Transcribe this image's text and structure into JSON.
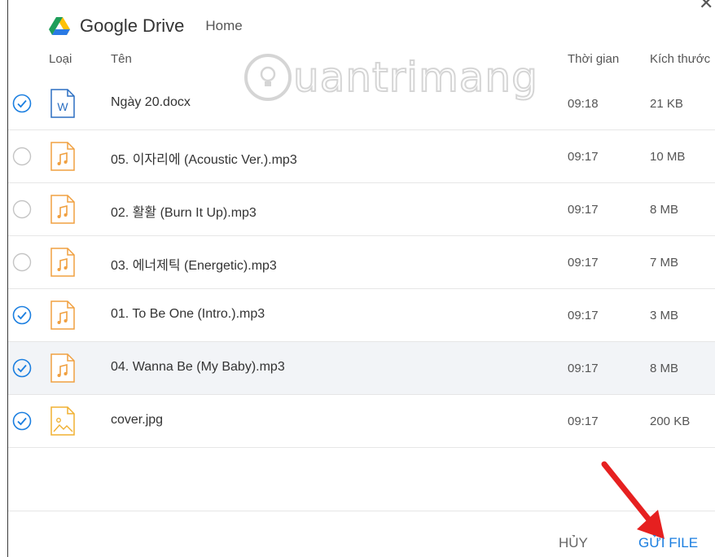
{
  "header": {
    "app_title": "Google Drive",
    "breadcrumb": "Home",
    "close_glyph": "✕"
  },
  "columns": {
    "type": "Loại",
    "name": "Tên",
    "time": "Thời gian",
    "size": "Kích thước"
  },
  "watermark": {
    "text": "uantrimang"
  },
  "files": [
    {
      "name": "Ngày 20.docx",
      "time": "09:18",
      "size": "21 KB",
      "checked": true,
      "icon": "word-doc-icon"
    },
    {
      "name": "05. 이자리에 (Acoustic Ver.).mp3",
      "time": "09:17",
      "size": "10 MB",
      "checked": false,
      "icon": "music-file-icon"
    },
    {
      "name": "02. 활활 (Burn It Up).mp3",
      "time": "09:17",
      "size": "8 MB",
      "checked": false,
      "icon": "music-file-icon"
    },
    {
      "name": "03. 에너제틱 (Energetic).mp3",
      "time": "09:17",
      "size": "7 MB",
      "checked": false,
      "icon": "music-file-icon"
    },
    {
      "name": "01. To Be One (Intro.).mp3",
      "time": "09:17",
      "size": "3 MB",
      "checked": true,
      "icon": "music-file-icon"
    },
    {
      "name": "04. Wanna Be (My Baby).mp3",
      "time": "09:17",
      "size": "8 MB",
      "checked": true,
      "icon": "music-file-icon"
    },
    {
      "name": "cover.jpg",
      "time": "09:17",
      "size": "200 KB",
      "checked": true,
      "icon": "image-file-icon"
    }
  ],
  "footer": {
    "cancel_label": "HỦY",
    "send_label": "GỬI FILE"
  },
  "colors": {
    "accent": "#1a7ee0",
    "music_icon": "#f0a040",
    "word_icon": "#2b6fc2",
    "annotation_arrow": "#e62020"
  }
}
